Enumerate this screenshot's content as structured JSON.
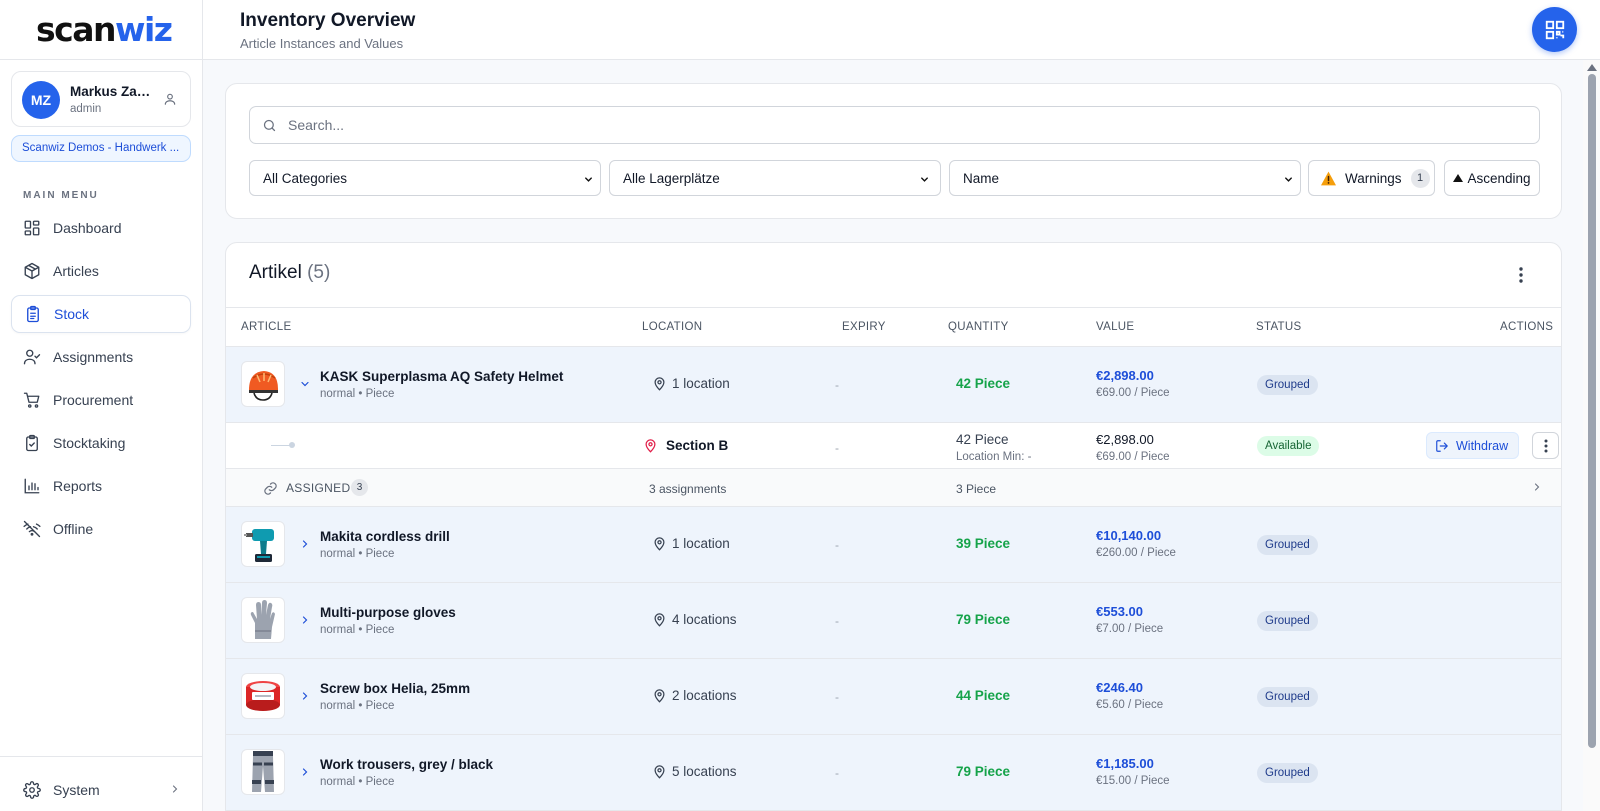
{
  "brand": {
    "logo_prefix": "scan",
    "logo_suffix": "wiz"
  },
  "user": {
    "initials": "MZ",
    "name": "Markus Zau...",
    "role": "admin"
  },
  "org": {
    "name": "Scanwiz Demos - Handwerk ..."
  },
  "sidebar": {
    "menu_title": "MAIN MENU",
    "items": [
      {
        "label": "Dashboard",
        "icon": "dashboard-icon"
      },
      {
        "label": "Articles",
        "icon": "box-icon"
      },
      {
        "label": "Stock",
        "icon": "clipboard-icon",
        "active": true
      },
      {
        "label": "Assignments",
        "icon": "user-check-icon"
      },
      {
        "label": "Procurement",
        "icon": "cart-icon"
      },
      {
        "label": "Stocktaking",
        "icon": "clipboard-check-icon"
      },
      {
        "label": "Reports",
        "icon": "bar-chart-icon"
      },
      {
        "label": "Offline",
        "icon": "wifi-off-icon"
      }
    ],
    "system_label": "System"
  },
  "header": {
    "title": "Inventory Overview",
    "subtitle": "Article Instances and Values"
  },
  "filters": {
    "search_placeholder": "Search...",
    "category": "All Categories",
    "location": "Alle Lagerplätze",
    "sort_field": "Name",
    "warnings_label": "Warnings",
    "warnings_count": "1",
    "order_label": "Ascending"
  },
  "table": {
    "title": "Artikel",
    "count": "(5)",
    "columns": {
      "article": "ARTICLE",
      "location": "LOCATION",
      "expiry": "EXPIRY",
      "quantity": "QUANTITY",
      "value": "VALUE",
      "status": "STATUS",
      "actions": "ACTIONS"
    },
    "rows": [
      {
        "name": "KASK Superplasma AQ Safety Helmet",
        "meta": "normal • Piece",
        "location": "1 location",
        "expiry": "-",
        "quantity": "42 Piece",
        "value": "€2,898.00",
        "unit_price": "€69.00 / Piece",
        "status": "Grouped",
        "thumb": "helmet-image"
      },
      {
        "name": "Makita cordless drill",
        "meta": "normal • Piece",
        "location": "1 location",
        "expiry": "-",
        "quantity": "39 Piece",
        "value": "€10,140.00",
        "unit_price": "€260.00 / Piece",
        "status": "Grouped",
        "thumb": "drill-image"
      },
      {
        "name": "Multi-purpose gloves",
        "meta": "normal • Piece",
        "location": "4 locations",
        "expiry": "-",
        "quantity": "79 Piece",
        "value": "€553.00",
        "unit_price": "€7.00 / Piece",
        "status": "Grouped",
        "thumb": "gloves-image"
      },
      {
        "name": "Screw box Helia, 25mm",
        "meta": "normal • Piece",
        "location": "2 locations",
        "expiry": "-",
        "quantity": "44 Piece",
        "value": "€246.40",
        "unit_price": "€5.60 / Piece",
        "status": "Grouped",
        "thumb": "screw-box-image"
      },
      {
        "name": "Work trousers, grey / black",
        "meta": "normal • Piece",
        "location": "5 locations",
        "expiry": "-",
        "quantity": "79 Piece",
        "value": "€1,185.00",
        "unit_price": "€15.00 / Piece",
        "status": "Grouped",
        "thumb": "trousers-image"
      }
    ],
    "sub_row": {
      "location": "Section B",
      "expiry": "-",
      "quantity": "42 Piece",
      "location_min": "Location Min: -",
      "value": "€2,898.00",
      "unit_price": "€69.00 / Piece",
      "status": "Available",
      "withdraw_label": "Withdraw"
    },
    "assigned_row": {
      "label": "ASSIGNED",
      "count": "3",
      "assignments": "3 assignments",
      "quantity": "3 Piece"
    }
  },
  "colors": {
    "accent": "#2563eb",
    "quantity_green": "#16a34a",
    "group_row_bg": "#eef4fc",
    "available_bg": "#dcfce7"
  }
}
